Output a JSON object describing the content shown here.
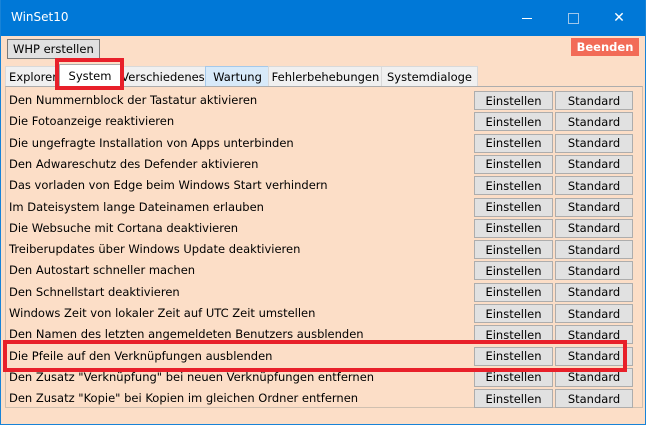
{
  "window": {
    "title": "WinSet10"
  },
  "toolbar": {
    "whp_label": "WHP erstellen",
    "exit_label": "Beenden"
  },
  "tabs": [
    {
      "label": "Explorer"
    },
    {
      "label": "System"
    },
    {
      "label": "Verschiedenes"
    },
    {
      "label": "Wartung"
    },
    {
      "label": "Fehlerbehebungen"
    },
    {
      "label": "Systemdialoge"
    }
  ],
  "active_tab": "System",
  "button_labels": {
    "set": "Einstellen",
    "default": "Standard"
  },
  "rows": [
    {
      "label": "Den Nummernblock der Tastatur aktivieren"
    },
    {
      "label": "Die Fotoanzeige reaktivieren"
    },
    {
      "label": "Die ungefragte Installation von Apps unterbinden"
    },
    {
      "label": "Den Adwareschutz des Defender aktivieren"
    },
    {
      "label": "Das vorladen von Edge beim Windows Start verhindern"
    },
    {
      "label": "Im Dateisystem lange Dateinamen erlauben"
    },
    {
      "label": "Die Websuche mit Cortana deaktivieren"
    },
    {
      "label": "Treiberupdates über Windows Update deaktivieren"
    },
    {
      "label": "Den Autostart schneller machen"
    },
    {
      "label": "Den Schnellstart deaktivieren"
    },
    {
      "label": "Windows Zeit von lokaler Zeit auf UTC Zeit umstellen"
    },
    {
      "label": "Den Namen des letzten angemeldeten Benutzers ausblenden"
    },
    {
      "label": "Die Pfeile auf den Verknüpfungen ausblenden"
    },
    {
      "label": "Den Zusatz \"Verknüpfung\" bei neuen Verknüpfungen entfernen"
    },
    {
      "label": "Den Zusatz \"Kopie\" bei Kopien im gleichen Ordner entfernen"
    }
  ],
  "colors": {
    "titlebar": "#0078d7",
    "panel": "#fcdec7",
    "exit_button": "#f26b57",
    "highlight": "#e8202a"
  }
}
